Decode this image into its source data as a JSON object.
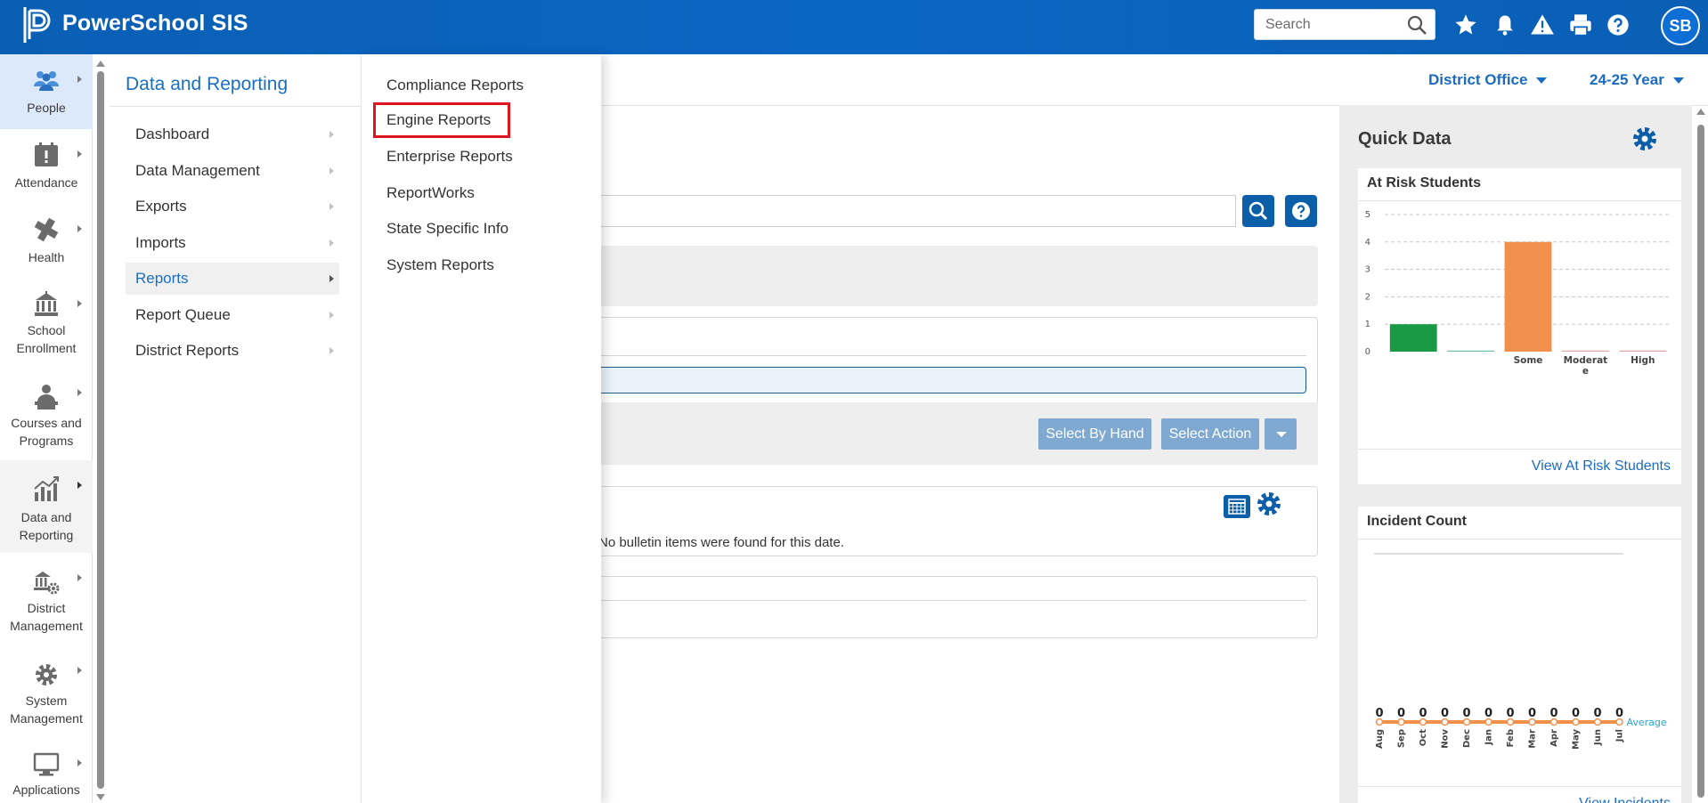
{
  "header": {
    "brand": "PowerSchool SIS",
    "search_placeholder": "Search",
    "avatar_initials": "SB",
    "bg_color": "#0b64be"
  },
  "sidebar": {
    "items": [
      {
        "label": "People",
        "icon": "people-icon"
      },
      {
        "label": "Attendance",
        "icon": "attendance-icon"
      },
      {
        "label": "Health",
        "icon": "health-icon"
      },
      {
        "label": "School Enrollment",
        "line1": "School",
        "line2": "Enrollment",
        "icon": "school-icon"
      },
      {
        "label": "Courses and Programs",
        "line1": "Courses and",
        "line2": "Programs",
        "icon": "courses-icon"
      },
      {
        "label": "Data and Reporting",
        "line1": "Data and",
        "line2": "Reporting",
        "icon": "chart-icon"
      },
      {
        "label": "District Management",
        "line1": "District",
        "line2": "Management",
        "icon": "district-icon"
      },
      {
        "label": "System Management",
        "line1": "System",
        "line2": "Management",
        "icon": "gear-icon"
      },
      {
        "label": "Applications",
        "icon": "monitor-icon"
      }
    ]
  },
  "flyout1": {
    "title": "Data and Reporting",
    "items": [
      "Dashboard",
      "Data Management",
      "Exports",
      "Imports",
      "Reports",
      "Report Queue",
      "District Reports"
    ],
    "selected": "Reports"
  },
  "flyout2": {
    "items": [
      "Compliance Reports",
      "Engine Reports",
      "Enterprise Reports",
      "ReportWorks",
      "State Specific Info",
      "System Reports"
    ],
    "highlighted": "Engine Reports",
    "highlight_color": "#e0141e"
  },
  "context": {
    "school": "District Office",
    "year": "24-25 Year"
  },
  "main": {
    "select_by_hand": "Select By Hand",
    "select_action": "Select Action",
    "bulletin_empty": "No bulletin items were found for this date."
  },
  "quick_data": {
    "title": "Quick Data",
    "at_risk": {
      "title": "At Risk Students",
      "link": "View At Risk Students"
    },
    "incidents": {
      "title": "Incident Count",
      "link": "View Incidents"
    }
  },
  "chart_data": [
    {
      "type": "bar",
      "categories": [
        "",
        "",
        "Some",
        "Moderate",
        "High"
      ],
      "values": [
        1,
        0,
        4,
        0,
        0
      ],
      "colors": [
        "#1a9a45",
        "#6fbfa0",
        "#f0904a",
        "#e9a2a2",
        "#e9a2a2"
      ],
      "ylim": [
        0,
        5
      ],
      "yticks": [
        0,
        1,
        2,
        3,
        4,
        5
      ],
      "grid": true
    },
    {
      "type": "line",
      "x": [
        "Aug",
        "Sep",
        "Oct",
        "Nov",
        "Dec",
        "Jan",
        "Feb",
        "Mar",
        "Apr",
        "May",
        "Jun",
        "Jul"
      ],
      "values": [
        0,
        0,
        0,
        0,
        0,
        0,
        0,
        0,
        0,
        0,
        0,
        0
      ],
      "series": [
        {
          "name": "Average",
          "values": [
            0,
            0,
            0,
            0,
            0,
            0,
            0,
            0,
            0,
            0,
            0,
            0
          ]
        }
      ],
      "color": "#f0904a"
    }
  ]
}
